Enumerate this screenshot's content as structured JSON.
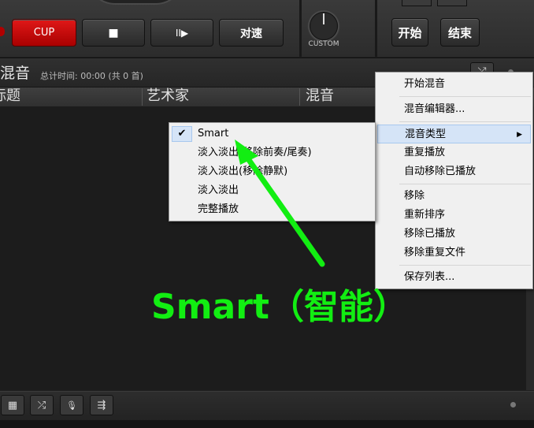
{
  "deck": {
    "cup_label": "CUP",
    "stop_icon": "■",
    "playpause_icon": "II▶",
    "sync_label": "对速",
    "custom_label": "CUSTOM",
    "start_label": "开始",
    "end_label": "结束"
  },
  "playlist": {
    "title": "混音",
    "total_time": "总计时间: 00:00 (共 0 首)",
    "columns": [
      "标题",
      "艺术家",
      "混音"
    ],
    "shuffle_icon": "⤮"
  },
  "context_menu": {
    "items": [
      "开始混音",
      "混音编辑器...",
      "混音类型",
      "重复播放",
      "自动移除已播放",
      "移除",
      "重新排序",
      "移除已播放",
      "移除重复文件",
      "保存列表..."
    ],
    "highlighted": "混音类型",
    "submenu_arrow": "▶"
  },
  "mix_type_submenu": {
    "items": [
      "Smart",
      "淡入淡出(移除前奏/尾奏)",
      "淡入淡出(移除静默)",
      "淡入淡出",
      "完整播放"
    ],
    "checked": "Smart",
    "check_icon": "✔"
  },
  "bottom_toolbar": {
    "icons": [
      "grid-icon",
      "shuffle-icon",
      "microphone-icon",
      "playlist-add-icon"
    ],
    "glyphs": [
      "▦",
      "⤮",
      "🎙",
      "⇶"
    ]
  },
  "annotation": {
    "text": "Smart（智能）",
    "color": "#12ee12"
  }
}
